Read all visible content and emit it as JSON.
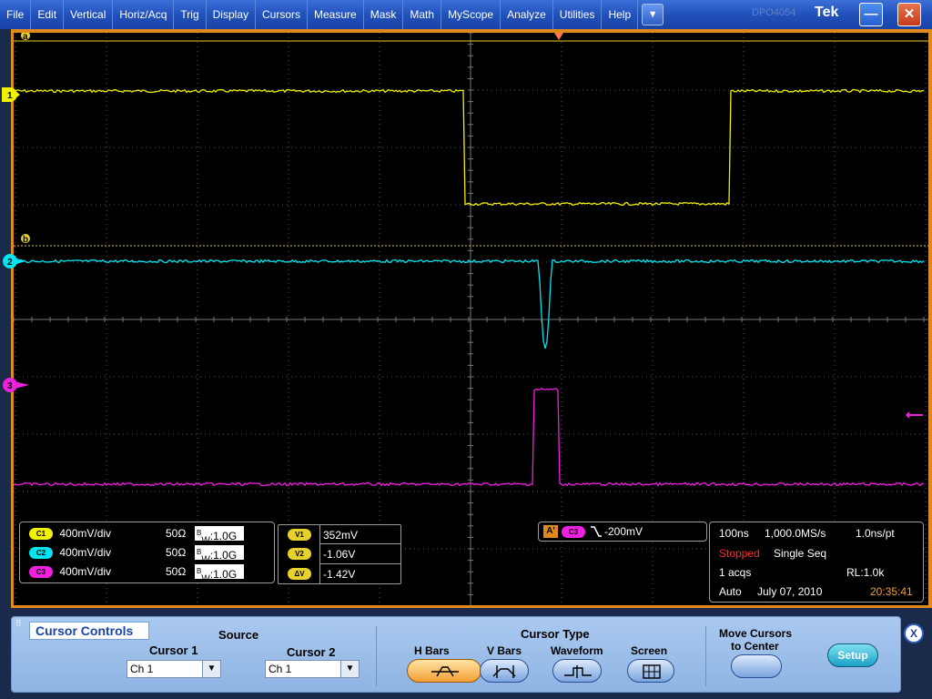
{
  "menu": {
    "items": [
      "File",
      "Edit",
      "Vertical",
      "Horiz/Acq",
      "Trig",
      "Display",
      "Cursors",
      "Measure",
      "Mask",
      "Math",
      "MyScope",
      "Analyze",
      "Utilities",
      "Help"
    ],
    "dropdown_icon": "chevron-down-icon",
    "brand_ghost": "DPO4054",
    "brand": "Tek",
    "minimize_icon": "minimize-icon",
    "close_icon": "close-icon"
  },
  "colors": {
    "ch1": "#f0f000",
    "ch2": "#00e5f0",
    "ch3": "#f020e0",
    "frame": "#e08a1e",
    "cursor": "#e6d22a"
  },
  "display": {
    "cursor_a_label": "a",
    "cursor_b_label": "b",
    "ch1_marker": "1",
    "ch2_marker": "2",
    "ch3_marker": "3"
  },
  "channels": [
    {
      "badge": "C1",
      "scale": "400mV/div",
      "termination": "50Ω",
      "bw_prefix": "B",
      "bw_sub": "W",
      "bw": ":1.0G"
    },
    {
      "badge": "C2",
      "scale": "400mV/div",
      "termination": "50Ω",
      "bw_prefix": "B",
      "bw_sub": "W",
      "bw": ":1.0G"
    },
    {
      "badge": "C3",
      "scale": "400mV/div",
      "termination": "50Ω",
      "bw_prefix": "B",
      "bw_sub": "W",
      "bw": ":1.0G"
    }
  ],
  "cursor_readout": [
    {
      "badge": "V1",
      "value": "352mV"
    },
    {
      "badge": "V2",
      "value": "-1.06V"
    },
    {
      "badge": "ΔV",
      "value": "-1.42V"
    }
  ],
  "trigger": {
    "badge_a": "A'",
    "source": "C3",
    "slope_icon": "falling-edge-icon",
    "level": "-200mV"
  },
  "acquisition": {
    "timebase": "100ns",
    "sample_rate": "1,000.0MS/s",
    "resolution": "1.0ns/pt",
    "status": "Stopped",
    "mode": "Single Seq",
    "acqs": "1 acqs",
    "record_length": "RL:1.0k",
    "trigger_mode": "Auto",
    "date": "July 07, 2010",
    "time": "20:35:41"
  },
  "cursor_panel": {
    "title": "Cursor Controls",
    "source_label": "Source",
    "cursor1_label": "Cursor 1",
    "cursor1_value": "Ch 1",
    "cursor2_label": "Cursor 2",
    "cursor2_value": "Ch 1",
    "type_label": "Cursor Type",
    "types": [
      {
        "label": "H Bars",
        "icon": "h-bars-icon",
        "active": true
      },
      {
        "label": "V Bars",
        "icon": "v-bars-icon",
        "active": false
      },
      {
        "label": "Waveform",
        "icon": "waveform-icon",
        "active": false
      },
      {
        "label": "Screen",
        "icon": "screen-grid-icon",
        "active": false
      }
    ],
    "move_label_1": "Move Cursors",
    "move_label_2": "to Center",
    "setup_label": "Setup",
    "close_label": "X"
  }
}
